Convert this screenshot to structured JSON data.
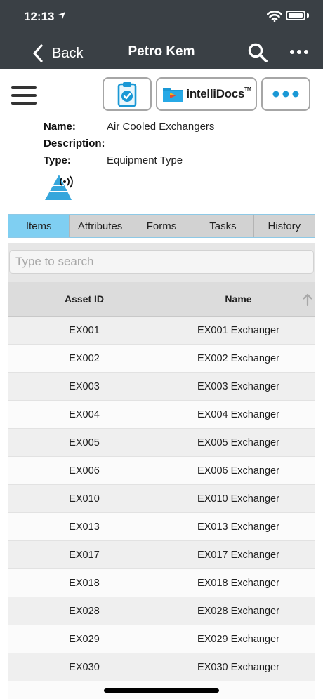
{
  "status_bar": {
    "time": "12:13"
  },
  "nav": {
    "back_label": "Back",
    "title": "Petro Kem"
  },
  "toolbar": {
    "docs_label": "intelliDocs",
    "docs_tm": "TM"
  },
  "info": {
    "name_label": "Name:",
    "name_value": "Air Cooled Exchangers",
    "description_label": "Description:",
    "description_value": "",
    "type_label": "Type:",
    "type_value": "Equipment Type"
  },
  "tabs": [
    {
      "label": "Items",
      "active": true
    },
    {
      "label": "Attributes",
      "active": false
    },
    {
      "label": "Forms",
      "active": false
    },
    {
      "label": "Tasks",
      "active": false
    },
    {
      "label": "History",
      "active": false
    }
  ],
  "search": {
    "placeholder": "Type to search"
  },
  "table": {
    "columns": [
      "Asset ID",
      "Name"
    ],
    "sort": {
      "column": "Name",
      "direction": "ascending"
    },
    "rows": [
      {
        "asset_id": "EX001",
        "name": "EX001 Exchanger"
      },
      {
        "asset_id": "EX002",
        "name": "EX002 Exchanger"
      },
      {
        "asset_id": "EX003",
        "name": "EX003 Exchanger"
      },
      {
        "asset_id": "EX004",
        "name": "EX004 Exchanger"
      },
      {
        "asset_id": "EX005",
        "name": "EX005 Exchanger"
      },
      {
        "asset_id": "EX006",
        "name": "EX006 Exchanger"
      },
      {
        "asset_id": "EX010",
        "name": "EX010 Exchanger"
      },
      {
        "asset_id": "EX013",
        "name": "EX013 Exchanger"
      },
      {
        "asset_id": "EX017",
        "name": "EX017 Exchanger"
      },
      {
        "asset_id": "EX018",
        "name": "EX018 Exchanger"
      },
      {
        "asset_id": "EX028",
        "name": "EX028 Exchanger"
      },
      {
        "asset_id": "EX029",
        "name": "EX029 Exchanger"
      },
      {
        "asset_id": "EX030",
        "name": "EX030 Exchanger"
      },
      {
        "asset_id": "",
        "name": ""
      }
    ]
  },
  "colors": {
    "nav_bg": "#3a4045",
    "active_tab": "#7fcff2",
    "tab_bg": "#d2d2d2",
    "brand_blue": "#1a98d5"
  },
  "icons": {
    "back": "chevron-left-icon",
    "search": "search-icon",
    "more": "ellipsis-icon",
    "menu": "hamburger-icon",
    "task": "clipboard-check-icon",
    "docs": "intellidocs-logo",
    "options": "ellipsis-icon",
    "type": "pyramid-signal-icon",
    "sort": "arrow-up-icon"
  }
}
